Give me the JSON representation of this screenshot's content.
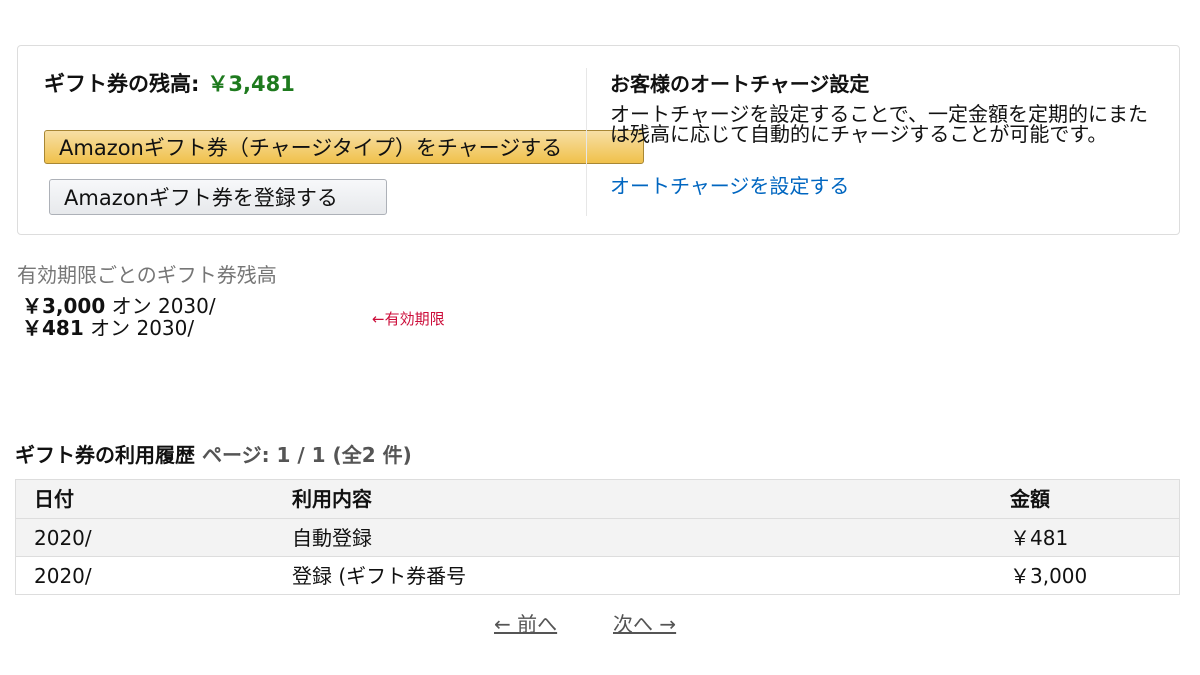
{
  "balance": {
    "label": "ギフト券の残高:",
    "amount": "￥3,481"
  },
  "buttons": {
    "charge": "Amazonギフト券（チャージタイプ）をチャージする",
    "register": "Amazonギフト券を登録する"
  },
  "auto_charge": {
    "title": "お客様のオートチャージ設定",
    "description": "オートチャージを設定することで、一定金額を定期的にまたは残高に応じて自動的にチャージすることが可能です。",
    "link": "オートチャージを設定する"
  },
  "expiry": {
    "heading": "有効期限ごとのギフト券残高",
    "rows": [
      {
        "amount": "￥3,000",
        "text": " オン 2030/"
      },
      {
        "amount": "￥481",
        "text": " オン 2030/"
      }
    ],
    "note": "←有効期限"
  },
  "history": {
    "title": "ギフト券の利用履歴",
    "page": "ページ: 1 / 1 (全2 件)",
    "columns": [
      "日付",
      "利用内容",
      "金額"
    ],
    "rows": [
      {
        "date": "2020/",
        "desc": "自動登録",
        "amount": "￥481"
      },
      {
        "date": "2020/",
        "desc": "登録 (ギフト券番号",
        "amount": "￥3,000"
      }
    ]
  },
  "pagination": {
    "prev": "← 前へ",
    "next": "次へ →"
  },
  "colors": {
    "balance": "#1e7a1e",
    "link": "#0066c0",
    "note": "#cc0c39",
    "button_primary": "#f0c14b"
  }
}
